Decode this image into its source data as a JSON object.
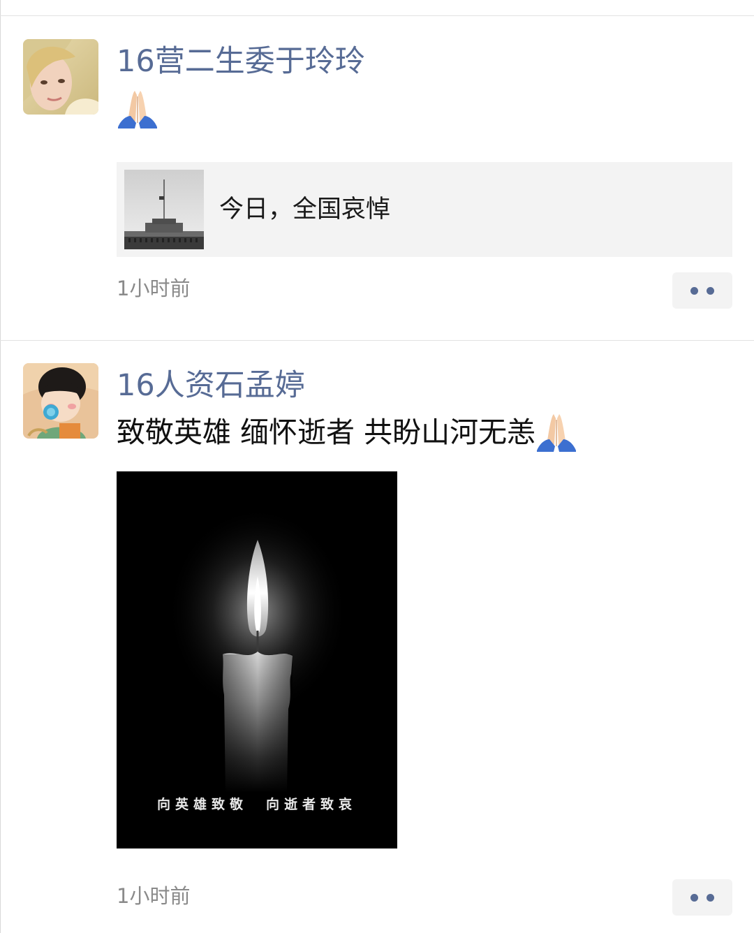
{
  "posts": [
    {
      "author": "16营二生委于玲玲",
      "text": "",
      "emoji": "folded-hands-emoji",
      "link": {
        "title": "今日，全国哀悼"
      },
      "time": "1小时前"
    },
    {
      "author": "16人资石孟婷",
      "text": "致敬英雄 缅怀逝者 共盼山河无恙",
      "emoji": "folded-hands-emoji",
      "image_caption": "向英雄致敬　向逝者致哀",
      "time": "1小时前"
    }
  ],
  "colors": {
    "author_name": "#576b95",
    "timestamp": "#8a8a8a",
    "card_background": "#f3f3f3",
    "divider": "#e2e2e2"
  }
}
